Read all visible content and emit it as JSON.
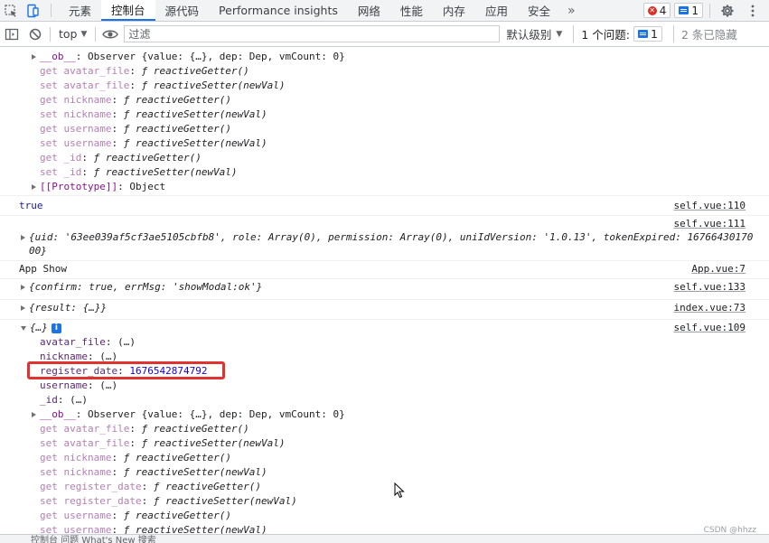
{
  "tabbar": {
    "tabs": [
      "元素",
      "控制台",
      "源代码",
      "Performance insights",
      "网络",
      "性能",
      "内存",
      "应用",
      "安全"
    ],
    "active_tab": "控制台",
    "more_label": "»",
    "error_count": "4",
    "message_count": "1"
  },
  "toolbar": {
    "context": "top",
    "filter_placeholder": "过滤",
    "levels_label": "默认级别",
    "issues_label": "1 个问题:",
    "issues_count": "1",
    "hidden_label": "2 条已隐藏"
  },
  "console": {
    "first_block": [
      {
        "prefix": "__ob__",
        "sep": ": ",
        "value": "Observer {value: {…}, dep: Dep, vmCount: 0}"
      },
      {
        "prefix": "get avatar_file",
        "sep": ": ",
        "value": "ƒ reactiveGetter()"
      },
      {
        "prefix": "set avatar_file",
        "sep": ": ",
        "value": "ƒ reactiveSetter(newVal)"
      },
      {
        "prefix": "get nickname",
        "sep": ": ",
        "value": "ƒ reactiveGetter()"
      },
      {
        "prefix": "set nickname",
        "sep": ": ",
        "value": "ƒ reactiveSetter(newVal)"
      },
      {
        "prefix": "get username",
        "sep": ": ",
        "value": "ƒ reactiveGetter()"
      },
      {
        "prefix": "set username",
        "sep": ": ",
        "value": "ƒ reactiveSetter(newVal)"
      },
      {
        "prefix": "get _id",
        "sep": ": ",
        "value": "ƒ reactiveGetter()"
      },
      {
        "prefix": "set _id",
        "sep": ": ",
        "value": "ƒ reactiveSetter(newVal)"
      },
      {
        "prefix": "[[Prototype]]",
        "sep": ": ",
        "value": "Object"
      }
    ],
    "true_line": "true",
    "src_110": "self.vue:110",
    "src_111": "self.vue:111",
    "uid_line_1": "{uid: '63ee039af5cf3ae5105cbfb8', role: Array(0), permission: Array(0), uniIdVersion: '1.0.13', tokenExpired: 16766430170",
    "uid_line_2": "00}",
    "app_show": "App Show",
    "src_app7": "App.vue:7",
    "confirm_line": "{confirm: true, errMsg: 'showModal:ok'}",
    "src_133": "self.vue:133",
    "result_line": "{result: {…}}",
    "src_index73": "index.vue:73",
    "obj_label": "{…}",
    "info_icon": "i",
    "src_109": "self.vue:109",
    "props": [
      {
        "key": "avatar_file",
        "value": "(…)"
      },
      {
        "key": "nickname",
        "value": "(…)"
      },
      {
        "key": "register_date",
        "value": "1676542874792"
      },
      {
        "key": "username",
        "value": "(…)"
      },
      {
        "key": "_id",
        "value": "(…)"
      }
    ],
    "second_block": [
      {
        "prefix": "__ob__",
        "sep": ": ",
        "value": "Observer {value: {…}, dep: Dep, vmCount: 0}"
      },
      {
        "prefix": "get avatar_file",
        "sep": ": ",
        "value": "ƒ reactiveGetter()"
      },
      {
        "prefix": "set avatar_file",
        "sep": ": ",
        "value": "ƒ reactiveSetter(newVal)"
      },
      {
        "prefix": "get nickname",
        "sep": ": ",
        "value": "ƒ reactiveGetter()"
      },
      {
        "prefix": "set nickname",
        "sep": ": ",
        "value": "ƒ reactiveSetter(newVal)"
      },
      {
        "prefix": "get register_date",
        "sep": ": ",
        "value": "ƒ reactiveGetter()"
      },
      {
        "prefix": "set register_date",
        "sep": ": ",
        "value": "ƒ reactiveSetter(newVal)"
      },
      {
        "prefix": "get username",
        "sep": ": ",
        "value": "ƒ reactiveGetter()"
      },
      {
        "prefix": "set username",
        "sep": ": ",
        "value": "ƒ reactiveSetter(newVal)"
      }
    ]
  },
  "watermark": "CSDN @hhzz",
  "bottom_strip": "控制台    问题    What's New    搜索"
}
